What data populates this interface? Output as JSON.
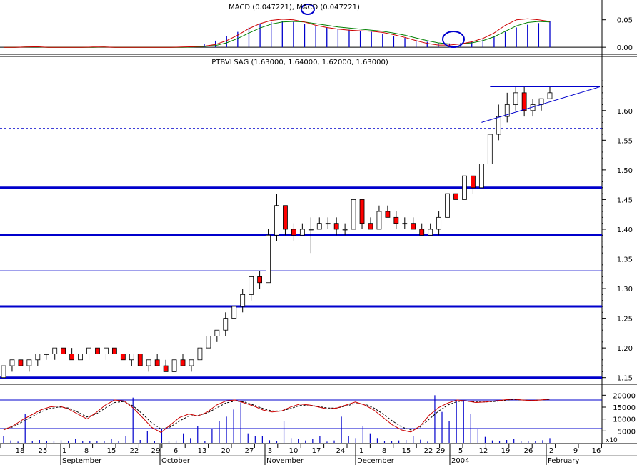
{
  "chart_data": [
    {
      "type": "bar",
      "panel": "macd",
      "title": "MACD (0.047221), MACD (0.047221)",
      "y_ticks": [
        "0.05",
        "0.00"
      ],
      "ylim": [
        -0.005,
        0.06
      ],
      "colors": {
        "macd_line": "#cc0000",
        "signal_line": "#008000",
        "histogram": "#0000cc"
      },
      "line_a": [
        0.0,
        0.0,
        0.0005,
        0.001,
        0.0,
        0.0,
        0.0,
        0.0,
        0.0005,
        0.0005,
        0.0,
        0.0,
        0.0,
        0.0,
        0.0,
        0.0,
        0.0005,
        0.001,
        0.002,
        0.005,
        0.012,
        0.022,
        0.034,
        0.043,
        0.049,
        0.051,
        0.05,
        0.046,
        0.04,
        0.036,
        0.033,
        0.031,
        0.03,
        0.029,
        0.027,
        0.023,
        0.018,
        0.012,
        0.007,
        0.004,
        0.004,
        0.006,
        0.01,
        0.016,
        0.026,
        0.04,
        0.05,
        0.052,
        0.05,
        0.047
      ],
      "line_b": [
        0.0,
        0.0,
        0.0005,
        0.0005,
        0.0,
        0.0,
        0.0,
        0.0,
        0.0,
        0.0005,
        0.0,
        0.0,
        0.0,
        0.0,
        0.0,
        0.0,
        0.0,
        0.0005,
        0.0015,
        0.003,
        0.008,
        0.016,
        0.026,
        0.035,
        0.042,
        0.046,
        0.047,
        0.046,
        0.043,
        0.04,
        0.037,
        0.035,
        0.033,
        0.031,
        0.029,
        0.026,
        0.022,
        0.017,
        0.012,
        0.008,
        0.006,
        0.006,
        0.008,
        0.012,
        0.019,
        0.029,
        0.039,
        0.045,
        0.047,
        0.046
      ],
      "histogram": [
        0.0,
        0.0,
        0.0,
        0.0,
        0.0,
        0.0,
        0.0,
        0.0,
        0.0,
        0.0,
        0.0,
        0.0,
        0.0,
        0.0,
        0.0,
        0.0,
        0.0,
        0.002,
        0.006,
        0.012,
        0.02,
        0.028,
        0.036,
        0.042,
        0.046,
        0.047,
        0.046,
        0.043,
        0.039,
        0.036,
        0.034,
        0.032,
        0.03,
        0.028,
        0.025,
        0.021,
        0.017,
        0.013,
        0.01,
        0.008,
        0.007,
        0.008,
        0.01,
        0.014,
        0.02,
        0.028,
        0.036,
        0.041,
        0.044,
        0.047
      ],
      "annotations": [
        "circle at peak",
        "circle at trough"
      ]
    },
    {
      "type": "candlestick",
      "panel": "price",
      "title": "PTBVLSAG (1.63000, 1.64000, 1.62000, 1.63000)",
      "y_ticks": [
        "1.60",
        "1.55",
        "1.50",
        "1.45",
        "1.40",
        "1.35",
        "1.30",
        "1.25",
        "1.20",
        "1.15"
      ],
      "ylim": [
        1.14,
        1.69
      ],
      "colors": {
        "up": "#ffffff",
        "down": "#ff0000",
        "support": "#0000cc"
      },
      "support_levels": [
        1.47,
        1.39,
        1.27,
        1.15
      ],
      "thin_levels": [
        1.33
      ],
      "dotted_level": 1.57,
      "triangle": {
        "top": 1.64,
        "apex_x": "February",
        "bottom_start": 1.58
      },
      "candles": [
        [
          1.15,
          1.17,
          1.15,
          1.17
        ],
        [
          1.17,
          1.18,
          1.16,
          1.18
        ],
        [
          1.18,
          1.18,
          1.17,
          1.17
        ],
        [
          1.17,
          1.18,
          1.16,
          1.18
        ],
        [
          1.18,
          1.19,
          1.17,
          1.19
        ],
        [
          1.19,
          1.19,
          1.18,
          1.19
        ],
        [
          1.19,
          1.2,
          1.18,
          1.2
        ],
        [
          1.2,
          1.2,
          1.19,
          1.19
        ],
        [
          1.19,
          1.2,
          1.18,
          1.18
        ],
        [
          1.18,
          1.19,
          1.18,
          1.19
        ],
        [
          1.19,
          1.2,
          1.18,
          1.2
        ],
        [
          1.2,
          1.2,
          1.19,
          1.19
        ],
        [
          1.19,
          1.2,
          1.18,
          1.2
        ],
        [
          1.2,
          1.2,
          1.19,
          1.19
        ],
        [
          1.19,
          1.19,
          1.18,
          1.18
        ],
        [
          1.18,
          1.19,
          1.17,
          1.19
        ],
        [
          1.19,
          1.19,
          1.17,
          1.17
        ],
        [
          1.17,
          1.18,
          1.16,
          1.18
        ],
        [
          1.18,
          1.19,
          1.17,
          1.17
        ],
        [
          1.17,
          1.18,
          1.16,
          1.16
        ],
        [
          1.16,
          1.18,
          1.16,
          1.18
        ],
        [
          1.18,
          1.19,
          1.17,
          1.17
        ],
        [
          1.17,
          1.18,
          1.16,
          1.18
        ],
        [
          1.18,
          1.2,
          1.18,
          1.2
        ],
        [
          1.2,
          1.22,
          1.2,
          1.22
        ],
        [
          1.22,
          1.23,
          1.21,
          1.23
        ],
        [
          1.23,
          1.26,
          1.22,
          1.25
        ],
        [
          1.25,
          1.27,
          1.25,
          1.27
        ],
        [
          1.27,
          1.3,
          1.26,
          1.29
        ],
        [
          1.29,
          1.32,
          1.28,
          1.32
        ],
        [
          1.32,
          1.33,
          1.3,
          1.31
        ],
        [
          1.31,
          1.4,
          1.31,
          1.39
        ],
        [
          1.39,
          1.46,
          1.38,
          1.44
        ],
        [
          1.44,
          1.44,
          1.39,
          1.4
        ],
        [
          1.4,
          1.41,
          1.38,
          1.39
        ],
        [
          1.39,
          1.41,
          1.39,
          1.4
        ],
        [
          1.4,
          1.42,
          1.36,
          1.4
        ],
        [
          1.4,
          1.42,
          1.4,
          1.41
        ],
        [
          1.41,
          1.42,
          1.4,
          1.41
        ],
        [
          1.41,
          1.42,
          1.39,
          1.4
        ],
        [
          1.4,
          1.41,
          1.39,
          1.4
        ],
        [
          1.4,
          1.45,
          1.4,
          1.45
        ],
        [
          1.45,
          1.45,
          1.4,
          1.41
        ],
        [
          1.41,
          1.42,
          1.4,
          1.4
        ],
        [
          1.4,
          1.44,
          1.4,
          1.43
        ],
        [
          1.43,
          1.44,
          1.42,
          1.42
        ],
        [
          1.42,
          1.43,
          1.4,
          1.41
        ],
        [
          1.41,
          1.42,
          1.4,
          1.41
        ],
        [
          1.41,
          1.42,
          1.4,
          1.4
        ],
        [
          1.4,
          1.41,
          1.39,
          1.39
        ],
        [
          1.39,
          1.41,
          1.39,
          1.4
        ],
        [
          1.4,
          1.43,
          1.39,
          1.42
        ],
        [
          1.42,
          1.46,
          1.42,
          1.46
        ],
        [
          1.46,
          1.47,
          1.44,
          1.45
        ],
        [
          1.45,
          1.49,
          1.45,
          1.49
        ],
        [
          1.49,
          1.49,
          1.46,
          1.47
        ],
        [
          1.47,
          1.51,
          1.47,
          1.51
        ],
        [
          1.51,
          1.56,
          1.53,
          1.56
        ],
        [
          1.56,
          1.61,
          1.55,
          1.59
        ],
        [
          1.59,
          1.63,
          1.58,
          1.61
        ],
        [
          1.61,
          1.64,
          1.6,
          1.63
        ],
        [
          1.63,
          1.64,
          1.59,
          1.6
        ],
        [
          1.6,
          1.62,
          1.59,
          1.61
        ],
        [
          1.61,
          1.62,
          1.6,
          1.62
        ],
        [
          1.62,
          1.64,
          1.62,
          1.63
        ]
      ]
    },
    {
      "type": "line",
      "panel": "stochastic",
      "y_ticks": [
        "20000",
        "15000",
        "10000",
        "5000"
      ],
      "y_unit": "x10",
      "colors": {
        "k_line": "#cc0000",
        "d_line": "#000000",
        "volume": "#0000cc"
      },
      "k": [
        20,
        28,
        40,
        50,
        60,
        66,
        68,
        62,
        52,
        42,
        55,
        70,
        80,
        78,
        64,
        45,
        25,
        15,
        30,
        45,
        52,
        48,
        56,
        70,
        78,
        80,
        74,
        68,
        60,
        56,
        58,
        66,
        72,
        70,
        66,
        62,
        64,
        70,
        76,
        70,
        60,
        45,
        30,
        20,
        16,
        28,
        50,
        65,
        74,
        80,
        78,
        75,
        76,
        78,
        80,
        82,
        80,
        79,
        80,
        82
      ],
      "d": [
        22,
        26,
        36,
        46,
        56,
        63,
        66,
        64,
        56,
        46,
        52,
        64,
        75,
        77,
        68,
        52,
        34,
        22,
        26,
        38,
        48,
        49,
        54,
        64,
        74,
        78,
        76,
        70,
        63,
        58,
        58,
        63,
        69,
        70,
        67,
        64,
        64,
        68,
        73,
        72,
        64,
        52,
        38,
        26,
        20,
        26,
        42,
        58,
        70,
        77,
        78,
        76,
        76,
        77,
        79,
        81,
        80,
        79,
        80,
        81
      ],
      "volume": [
        3000,
        1000,
        500,
        12000,
        800,
        1200,
        700,
        900,
        1100,
        600,
        1500,
        900,
        800,
        700,
        600,
        1800,
        900,
        3000,
        19000,
        1200,
        5000,
        700,
        6000,
        900,
        1000,
        4000,
        2000,
        7000,
        800,
        6000,
        9000,
        11000,
        14000,
        17000,
        4000,
        3000,
        3000,
        1100,
        800,
        9000,
        2000,
        1500,
        1000,
        1500,
        3000,
        500,
        1000,
        11000,
        3000,
        2000,
        7000,
        4000,
        2000,
        900,
        900,
        1000,
        1200,
        3000,
        1300,
        500,
        20000,
        13000,
        9000,
        18000,
        18000,
        12000,
        6000,
        2500,
        1000,
        900,
        1200,
        1500,
        800,
        600,
        900,
        1100,
        2000
      ],
      "ref_levels": [
        18000,
        6000
      ]
    }
  ],
  "x_axis": {
    "day_ticks": [
      "18",
      "25",
      "1",
      "8",
      "15",
      "22",
      "29",
      "6",
      "13",
      "20",
      "27",
      "3",
      "10",
      "17",
      "24",
      "1",
      "8",
      "15",
      "22",
      "29",
      "5",
      "12",
      "19",
      "26",
      "2",
      "9",
      "16"
    ],
    "month_labels": [
      "September",
      "October",
      "November",
      "December",
      "2004",
      "February"
    ]
  }
}
